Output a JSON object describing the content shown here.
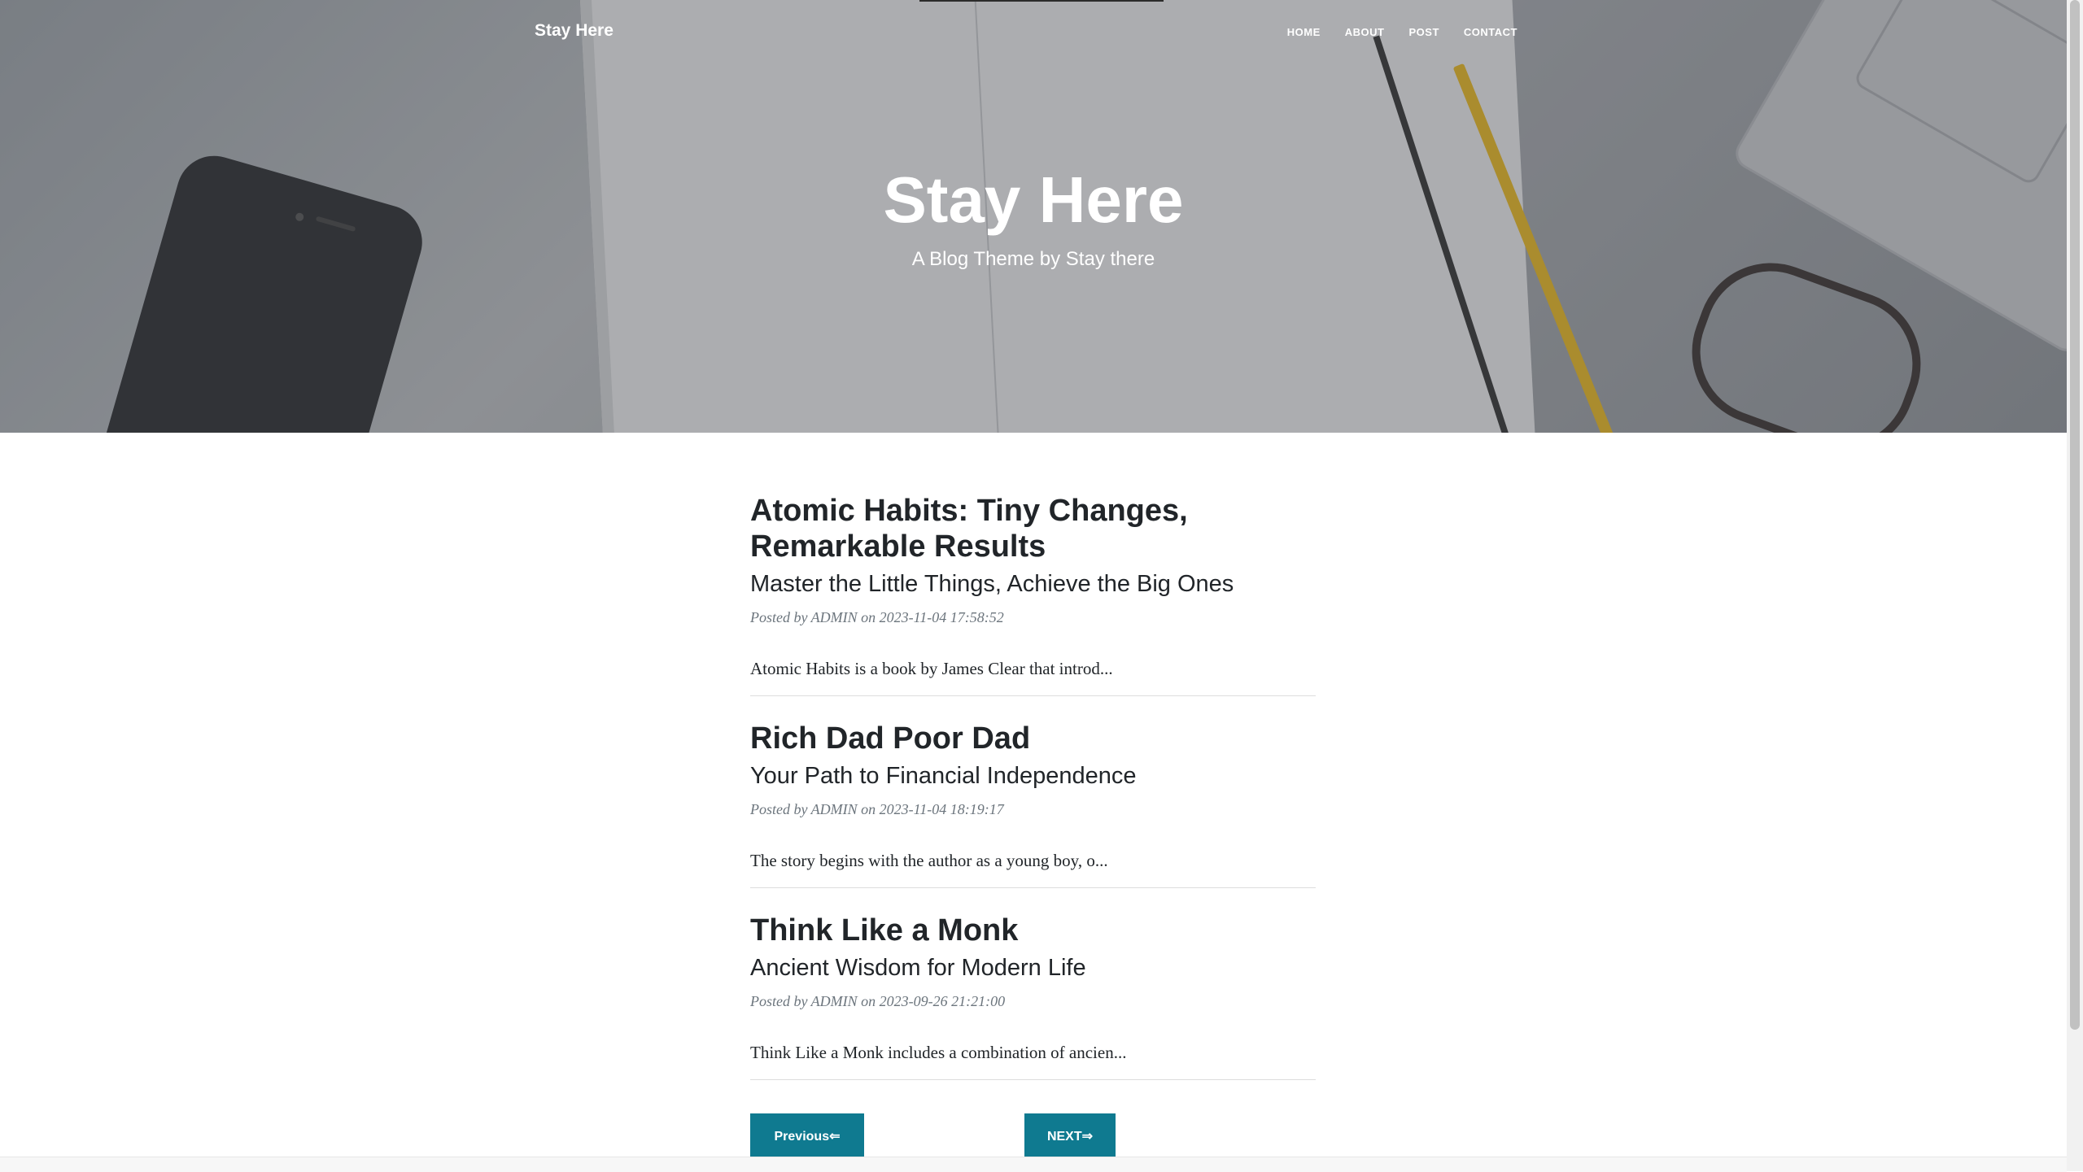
{
  "nav": {
    "brand": "Stay Here",
    "items": [
      {
        "label": "HOME"
      },
      {
        "label": "ABOUT"
      },
      {
        "label": "POST"
      },
      {
        "label": "CONTACT"
      }
    ]
  },
  "hero": {
    "title": "Stay Here",
    "subtitle": "A Blog Theme by Stay there"
  },
  "posts": [
    {
      "title": "Atomic Habits: Tiny Changes, Remarkable Results",
      "subtitle": "Master the Little Things, Achieve the Big Ones",
      "meta": "Posted by ADMIN on 2023-11-04 17:58:52",
      "excerpt": "Atomic Habits is a book by James Clear that introd..."
    },
    {
      "title": "Rich Dad Poor Dad",
      "subtitle": "Your Path to Financial Independence",
      "meta": "Posted by ADMIN on 2023-11-04 18:19:17",
      "excerpt": "The story begins with the author as a young boy, o..."
    },
    {
      "title": "Think Like a Monk",
      "subtitle": "Ancient Wisdom for Modern Life",
      "meta": "Posted by ADMIN on 2023-09-26 21:21:00",
      "excerpt": "Think Like a Monk includes a combination of ancien..."
    }
  ],
  "pager": {
    "previous": "Previous⇐",
    "next": "NEXT⇒"
  },
  "colors": {
    "accent": "#0f7a90",
    "text": "#212529",
    "meta": "#6c757d"
  }
}
